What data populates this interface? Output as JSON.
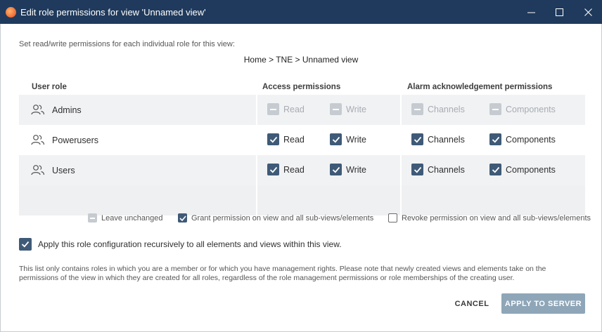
{
  "window": {
    "title": "Edit role permissions for view 'Unnamed view'",
    "controls": [
      "minimize-icon",
      "maximize-icon",
      "close-icon"
    ]
  },
  "intro_text": "Set read/write permissions for each individual role for this view:",
  "breadcrumb": "Home > TNE > Unnamed view",
  "columns": {
    "role": "User role",
    "access": "Access permissions",
    "alarm": "Alarm acknowledgement permissions"
  },
  "rows": [
    {
      "name": "Admins",
      "icon": "users-icon",
      "read": {
        "label": "Read",
        "state": "indeterminate"
      },
      "write": {
        "label": "Write",
        "state": "indeterminate"
      },
      "channels": {
        "label": "Channels",
        "state": "indeterminate"
      },
      "components": {
        "label": "Components",
        "state": "indeterminate"
      }
    },
    {
      "name": "Powerusers",
      "icon": "users-icon",
      "read": {
        "label": "Read",
        "state": "checked"
      },
      "write": {
        "label": "Write",
        "state": "checked"
      },
      "channels": {
        "label": "Channels",
        "state": "checked"
      },
      "components": {
        "label": "Components",
        "state": "checked"
      }
    },
    {
      "name": "Users",
      "icon": "users-icon",
      "read": {
        "label": "Read",
        "state": "checked"
      },
      "write": {
        "label": "Write",
        "state": "checked"
      },
      "channels": {
        "label": "Channels",
        "state": "checked"
      },
      "components": {
        "label": "Components",
        "state": "checked"
      }
    }
  ],
  "legend": {
    "leave": "Leave unchanged",
    "grant": "Grant permission on view and all sub-views/elements",
    "revoke": "Revoke permission on view and all sub-views/elements"
  },
  "recursive": {
    "label": "Apply this role configuration recursively to all elements and views within this view.",
    "checked": true
  },
  "note": "This list only contains roles in which you are a member or for which you have management rights. Please note that newly created views and elements take on the permissions of the view in which they are created for all roles, regardless of the role management permissions or role memberships of the creating user.",
  "buttons": {
    "cancel": "CANCEL",
    "apply": "APPLY TO SERVER"
  },
  "colors": {
    "titlebar": "#1f3a5c",
    "checkbox_checked": "#3f5a77",
    "checkbox_indeterminate": "#c6cbd1",
    "apply_button": "#8ea6b8"
  }
}
